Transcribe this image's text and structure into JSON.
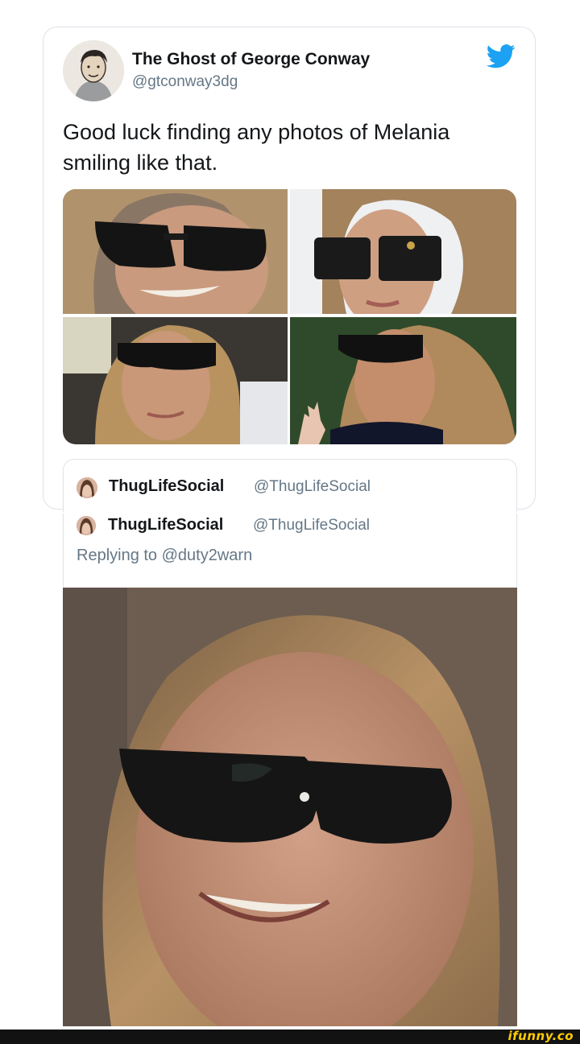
{
  "tweet": {
    "display_name": "The Ghost of George Conway",
    "handle": "@gtconway3dg",
    "text": "Good luck finding any photos of Melania smiling like that.",
    "brand_icon": "twitter-bird-icon",
    "brand_color": "#1da1f2",
    "photos": [
      {
        "name": "photo-smiling-closeup"
      },
      {
        "name": "photo-gucci-sunglasses"
      },
      {
        "name": "photo-black-sunglasses"
      },
      {
        "name": "photo-waving"
      }
    ]
  },
  "quoted_tweet": {
    "display_name": "ThugLifeSocial",
    "handle": "@ThugLifeSocial",
    "replying_to": "Replying to @duty2warn"
  },
  "watermark": {
    "text": "ifunny.co",
    "color": "#ffcc00"
  }
}
